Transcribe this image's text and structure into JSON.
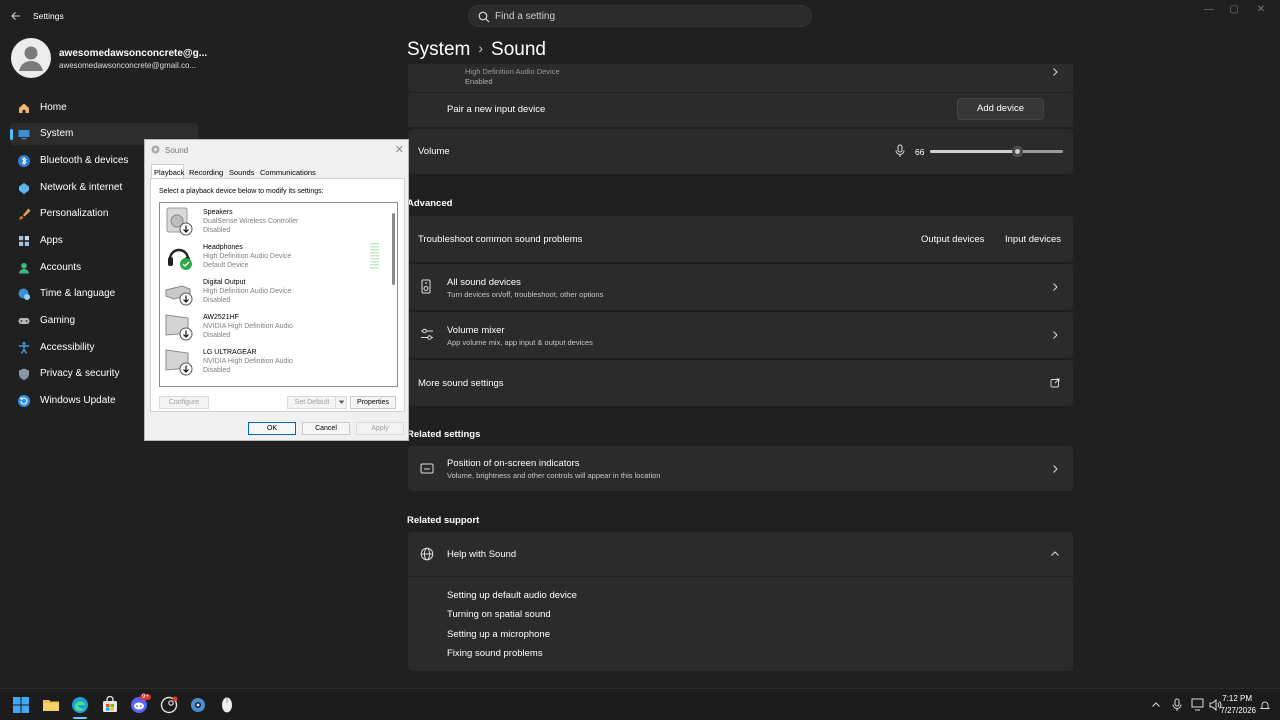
{
  "window": {
    "title": "Settings",
    "controls": [
      "—",
      "▢",
      "✕"
    ]
  },
  "search": {
    "placeholder": "Find a setting"
  },
  "profile": {
    "name": "awesomedawsonconcrete@g...",
    "email": "awesomedawsonconcrete@gmail.co..."
  },
  "nav": [
    {
      "label": "Home",
      "icon": "home-icon"
    },
    {
      "label": "System",
      "icon": "system-icon",
      "selected": true
    },
    {
      "label": "Bluetooth & devices",
      "icon": "bluetooth-icon"
    },
    {
      "label": "Network & internet",
      "icon": "network-icon"
    },
    {
      "label": "Personalization",
      "icon": "brush-icon"
    },
    {
      "label": "Apps",
      "icon": "apps-icon"
    },
    {
      "label": "Accounts",
      "icon": "accounts-icon"
    },
    {
      "label": "Time & language",
      "icon": "globe-clock-icon"
    },
    {
      "label": "Gaming",
      "icon": "gamepad-icon"
    },
    {
      "label": "Accessibility",
      "icon": "accessibility-icon"
    },
    {
      "label": "Privacy & security",
      "icon": "shield-icon"
    },
    {
      "label": "Windows Update",
      "icon": "update-icon"
    }
  ],
  "breadcrumb": {
    "parent": "System",
    "current": "Sound"
  },
  "main": {
    "input_device": {
      "desc": "High Definition Audio Device",
      "status": "Enabled"
    },
    "pair": {
      "label": "Pair a new input device",
      "button": "Add device"
    },
    "volume": {
      "label": "Volume",
      "value": "66",
      "level": 66
    },
    "advanced_heading": "Advanced",
    "troubleshoot": {
      "label": "Troubleshoot common sound problems",
      "output_button": "Output devices",
      "input_button": "Input devices"
    },
    "all_devices": {
      "title": "All sound devices",
      "desc": "Turn devices on/off, troubleshoot, other options"
    },
    "mixer": {
      "title": "Volume mixer",
      "desc": "App volume mix, app input & output devices"
    },
    "more_settings": {
      "label": "More sound settings"
    },
    "related_settings_heading": "Related settings",
    "indicators": {
      "title": "Position of on-screen indicators",
      "desc": "Volume, brightness and other controls will appear in this location"
    },
    "related_support_heading": "Related support",
    "help": {
      "title": "Help with Sound",
      "links": [
        "Setting up default audio device",
        "Turning on spatial sound",
        "Setting up a microphone",
        "Fixing sound problems"
      ]
    }
  },
  "dialog": {
    "title": "Sound",
    "close": "✕",
    "tabs": [
      "Playback",
      "Recording",
      "Sounds",
      "Communications"
    ],
    "instruction": "Select a playback device below to modify its settings:",
    "devices": [
      {
        "name": "Speakers",
        "desc": "DualSense Wireless Controller",
        "status": "Disabled"
      },
      {
        "name": "Headphones",
        "desc": "High Definition Audio Device",
        "status": "Default Device"
      },
      {
        "name": "Digital Output",
        "desc": "High Definition Audio Device",
        "status": "Disabled"
      },
      {
        "name": "AW2521HF",
        "desc": "NVIDIA High Definition Audio",
        "status": "Disabled"
      },
      {
        "name": "LG ULTRAGEAR",
        "desc": "NVIDIA High Definition Audio",
        "status": "Disabled"
      }
    ],
    "buttons": {
      "configure": "Configure",
      "set_default": "Set Default",
      "properties": "Properties",
      "ok": "OK",
      "cancel": "Cancel",
      "apply": "Apply"
    }
  },
  "taskbar": {
    "badges": {
      "discord": "9+"
    },
    "time": "7:12 PM",
    "date": "7/27/2026"
  },
  "colors": {
    "accent": "#4cc2ff",
    "background": "#202020",
    "card": "#2b2b2b"
  }
}
